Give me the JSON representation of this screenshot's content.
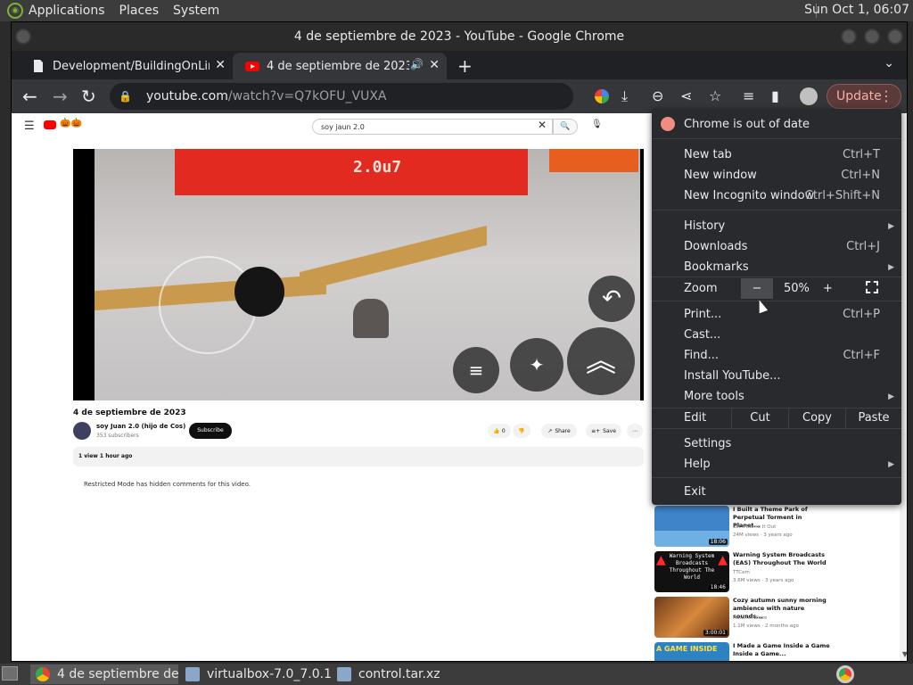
{
  "panel": {
    "applications": "Applications",
    "places": "Places",
    "system": "System",
    "clock": "Sun Oct  1, 06:07"
  },
  "window": {
    "title": "4 de septiembre de 2023 - YouTube - Google Chrome"
  },
  "tabs": [
    {
      "title": "Development/BuildingOnLinux",
      "active": false
    },
    {
      "title": "4 de septiembre de 2023 - ",
      "active": true,
      "audio": "🔊"
    }
  ],
  "toolbar": {
    "url_host": "youtube.com",
    "url_path": "/watch?v=Q7kOFU_VUXA",
    "update_label": "Update"
  },
  "youtube": {
    "search_query": "soy jaun 2.0",
    "video": {
      "score_overlay": "2.0u7",
      "title": "4 de septiembre de 2023",
      "channel": "soy Juan 2.0 (hijo de Cos)",
      "subscribers": "353 subscribers",
      "subscribe": "Subscribe",
      "likes": "0",
      "share": "Share",
      "save": "Save",
      "views_time": "1 view  1 hour ago",
      "restricted": "Restricted Mode has hidden comments for this video."
    },
    "recommendations": [
      {
        "title": "I Built a Theme Park of Perpetual Torment in Planet...",
        "channel": "Let's Game It Out",
        "meta": "24M views  ·  3 years ago",
        "duration": "18:06",
        "thumb_color": "#3f83c9"
      },
      {
        "title": "Warning System Broadcasts (EAS) Throughout The World",
        "channel": "TTCem",
        "meta": "3.6M views  ·  3 years ago",
        "duration": "18:46",
        "thumb_color": "#111111",
        "thumb_text": "Warning System Broadcasts Throughout The World"
      },
      {
        "title": "Cozy autumn sunny morning ambience with nature sounds...",
        "channel": "Autumn Blaze",
        "meta": "1.1M views  ·  2 months ago",
        "duration": "3:00:01",
        "thumb_color": "#b8642a"
      },
      {
        "title": "I Made a Game Inside a Game Inside a Game...",
        "channel": "",
        "meta": "",
        "duration": "",
        "thumb_color": "#2d82c4",
        "thumb_text": "A GAME INSIDE"
      }
    ]
  },
  "app_menu": {
    "outdated": "Chrome is out of date",
    "items": [
      {
        "label": "New tab",
        "accel": "Ctrl+T"
      },
      {
        "label": "New window",
        "accel": "Ctrl+N"
      },
      {
        "label": "New Incognito window",
        "accel": "Ctrl+Shift+N"
      },
      {
        "label": "History",
        "accel": ""
      },
      {
        "label": "Downloads",
        "accel": "Ctrl+J"
      },
      {
        "label": "Bookmarks",
        "accel": ""
      },
      {
        "label": "Print...",
        "accel": "Ctrl+P"
      },
      {
        "label": "Cast...",
        "accel": ""
      },
      {
        "label": "Find...",
        "accel": "Ctrl+F"
      },
      {
        "label": "Install YouTube...",
        "accel": ""
      },
      {
        "label": "More tools",
        "accel": ""
      },
      {
        "label": "Settings",
        "accel": ""
      },
      {
        "label": "Help",
        "accel": ""
      },
      {
        "label": "Exit",
        "accel": ""
      }
    ],
    "zoom": {
      "label": "Zoom",
      "minus": "−",
      "value": "50%",
      "plus": "+"
    },
    "edit": {
      "label": "Edit",
      "cut": "Cut",
      "copy": "Copy",
      "paste": "Paste"
    }
  },
  "taskbar": [
    {
      "label": "4 de septiembre de ...",
      "active": true
    },
    {
      "label": "virtualbox-7.0_7.0.1...",
      "active": false
    },
    {
      "label": "control.tar.xz",
      "active": false
    }
  ],
  "colors": {
    "accent_update": "#f6aea9",
    "youtube_red": "#ff0000",
    "menu_bg": "#292a2d"
  }
}
